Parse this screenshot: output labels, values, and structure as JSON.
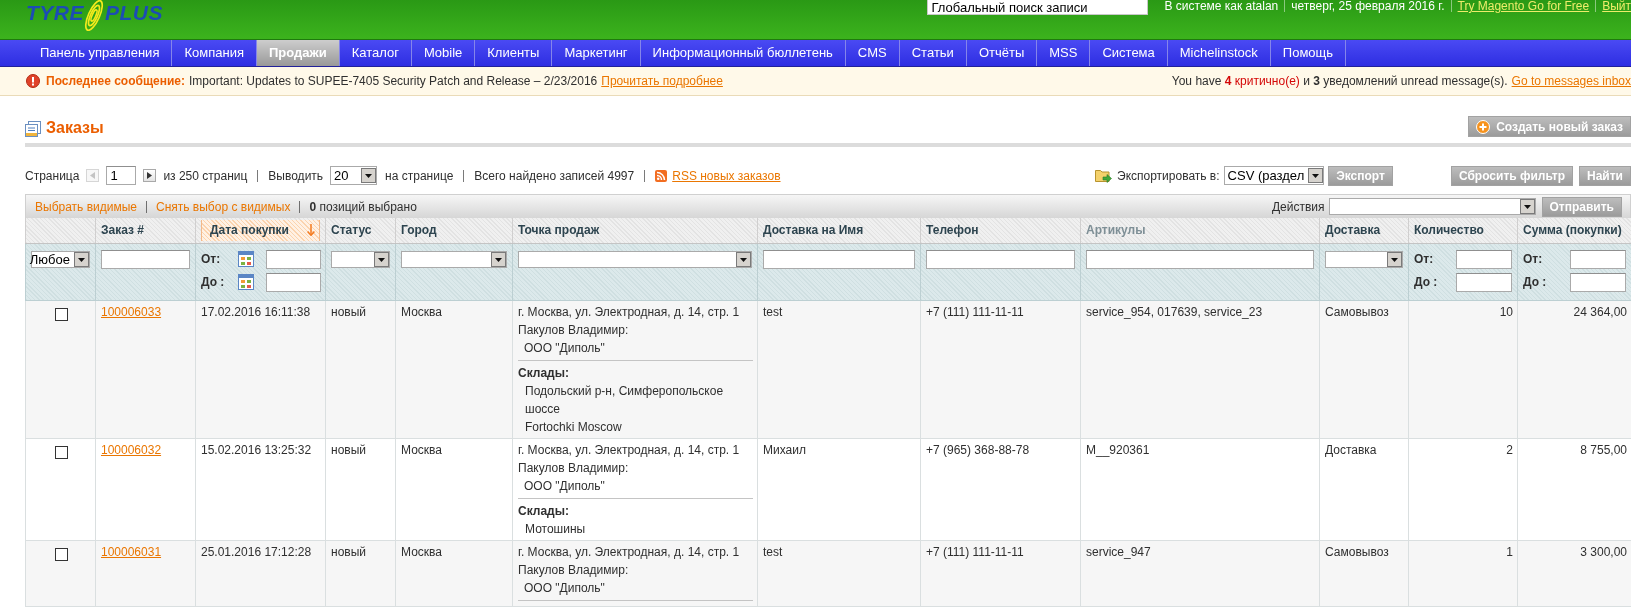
{
  "header": {
    "logo": [
      "TYRE",
      "PLUS"
    ],
    "search": {
      "placeholder": "Глобальный поиск записи"
    },
    "user": "В системе как atalan",
    "date": "четверг, 25 февраля 2016 г.",
    "links": [
      {
        "label": "Try Magento Go for Free"
      },
      {
        "label": "Выйт"
      }
    ]
  },
  "nav": {
    "items": [
      {
        "label": "Панель управления",
        "selected": false
      },
      {
        "label": "Компания",
        "selected": false
      },
      {
        "label": "Продажи",
        "selected": true
      },
      {
        "label": "Каталог",
        "selected": false
      },
      {
        "label": "Mobile",
        "selected": false
      },
      {
        "label": "Клиенты",
        "selected": false
      },
      {
        "label": "Маркетинг",
        "selected": false
      },
      {
        "label": "Информационный бюллетень",
        "selected": false
      },
      {
        "label": "CMS",
        "selected": false
      },
      {
        "label": "Статьи",
        "selected": false
      },
      {
        "label": "Отчёты",
        "selected": false
      },
      {
        "label": "MSS",
        "selected": false
      },
      {
        "label": "Система",
        "selected": false
      },
      {
        "label": "Michelinstock",
        "selected": false
      },
      {
        "label": "Помощь",
        "selected": false
      }
    ]
  },
  "notice": {
    "label": "Последнее сообщение:",
    "text": "Important: Updates to SUPEE-7405 Security Patch and Release – 2/23/2016",
    "link": "Прочитать подробнее",
    "inbox": {
      "parts": [
        {
          "kind": "plain",
          "text": "You have"
        },
        {
          "kind": "critical_count",
          "text": "4"
        },
        {
          "kind": "critical",
          "text": "критично(е)"
        },
        {
          "kind": "plain",
          "text": "и"
        },
        {
          "kind": "count",
          "text": "3"
        },
        {
          "kind": "plain",
          "text": "уведомлений unread message(s)."
        }
      ],
      "link": "Go to messages inbox"
    }
  },
  "page": {
    "title": "Заказы",
    "create_button": "Создать новый заказ"
  },
  "pager": {
    "page_label": "Страница",
    "previous": {
      "disabled": true
    },
    "page": "1",
    "next": {
      "disabled": false
    },
    "of_pages": "из 250 страниц",
    "per_page_label": "Выводить",
    "per_page": "20",
    "per_page_suffix": "на странице",
    "total": "Всего найдено записей 4997",
    "rss_link": "RSS новых заказов"
  },
  "export": {
    "label": "Экспортировать в:",
    "format": "CSV (раздел",
    "button": "Экспорт"
  },
  "filter_buttons": [
    "Сбросить фильтр",
    "Найти"
  ],
  "massaction": {
    "links": [
      "Выбрать видимые",
      "Снять выбор с видимых"
    ],
    "selected_count": "**0** позиций выбрано",
    "actions_label": "Действия",
    "submit": "Отправить"
  },
  "table": {
    "select_filter": "Любое",
    "columns": [
      {
        "label": "Заказ #",
        "sortable": true,
        "sorted": false,
        "filter": {
          "kind": "text"
        }
      },
      {
        "label": "Дата покупки",
        "sortable": true,
        "sorted": true,
        "filter": {
          "kind": "date_range",
          "from_label": "От:",
          "to_label": "До :"
        }
      },
      {
        "label": "Статус",
        "sortable": true,
        "sorted": false,
        "filter": {
          "kind": "select"
        }
      },
      {
        "label": "Город",
        "sortable": true,
        "sorted": false,
        "filter": {
          "kind": "select"
        }
      },
      {
        "label": "Точка продаж",
        "sortable": true,
        "sorted": false,
        "filter": {
          "kind": "select"
        }
      },
      {
        "label": "Доставка на Имя",
        "sortable": true,
        "sorted": false,
        "filter": {
          "kind": "text"
        }
      },
      {
        "label": "Телефон",
        "sortable": true,
        "sorted": false,
        "filter": {
          "kind": "text"
        }
      },
      {
        "label": "Артикулы",
        "sortable": false,
        "sorted": false,
        "filter": {
          "kind": "text"
        }
      },
      {
        "label": "Доставка",
        "sortable": true,
        "sorted": false,
        "filter": {
          "kind": "select"
        }
      },
      {
        "label": "Количество",
        "sortable": true,
        "sorted": false,
        "filter": {
          "kind": "range",
          "from_label": "От:",
          "to_label": "До :"
        }
      },
      {
        "label": "Сумма (покупки)",
        "sortable": true,
        "sorted": false,
        "filter": {
          "kind": "range",
          "from_label": "От:",
          "to_label": "До :"
        }
      }
    ],
    "rows": [
      {
        "checked": false,
        "order": "100006033",
        "date": "17.02.2016 16:11:38",
        "status": "новый",
        "city": "Москва",
        "point_of_sale": {
          "address": "г. Москва, ул. Электродная, д. 14, стр. 1",
          "manager": "Пакулов Владимир:",
          "company": "ООО \"Диполь\"",
          "warehouses_label": "Склады:",
          "warehouses": [
            "Подольский р-н, Симферопольское шоссе",
            "Fortochki Moscow"
          ]
        },
        "recipient": "test",
        "phone": "+7 (111) 111-11-11",
        "skus": "service_954, 017639, service_23",
        "delivery": "Самовывоз",
        "quantity": "10",
        "total": "24 364,00"
      },
      {
        "checked": false,
        "order": "100006032",
        "date": "15.02.2016 13:25:32",
        "status": "новый",
        "city": "Москва",
        "point_of_sale": {
          "address": "г. Москва, ул. Электродная, д. 14, стр. 1",
          "manager": "Пакулов Владимир:",
          "company": "ООО \"Диполь\"",
          "warehouses_label": "Склады:",
          "warehouses": [
            "Мотошины"
          ]
        },
        "recipient": "Михаил",
        "phone": "+7 (965) 368-88-78",
        "skus": "M__920361",
        "delivery": "Доставка",
        "quantity": "2",
        "total": "8 755,00"
      },
      {
        "checked": false,
        "order": "100006031",
        "date": "25.01.2016 17:12:28",
        "status": "новый",
        "city": "Москва",
        "point_of_sale": {
          "address": "г. Москва, ул. Электродная, д. 14, стр. 1",
          "manager": "Пакулов Владимир:",
          "company": "ООО \"Диполь\""
        },
        "recipient": "test",
        "phone": "+7 (111) 111-11-11",
        "skus": "service_947",
        "delivery": "Самовывоз",
        "quantity": "1",
        "total": "3 300,00"
      }
    ]
  }
}
